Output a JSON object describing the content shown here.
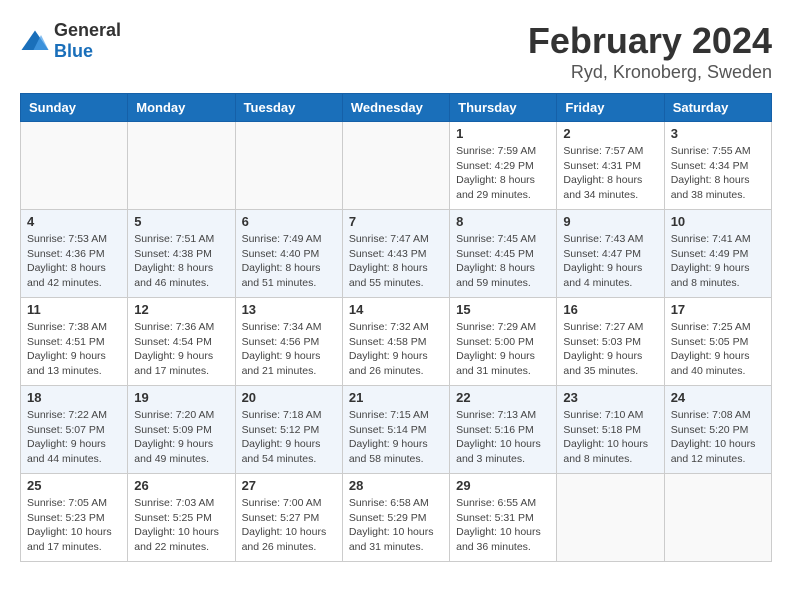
{
  "logo": {
    "general": "General",
    "blue": "Blue"
  },
  "title": "February 2024",
  "subtitle": "Ryd, Kronoberg, Sweden",
  "headers": [
    "Sunday",
    "Monday",
    "Tuesday",
    "Wednesday",
    "Thursday",
    "Friday",
    "Saturday"
  ],
  "weeks": [
    [
      {
        "day": "",
        "info": ""
      },
      {
        "day": "",
        "info": ""
      },
      {
        "day": "",
        "info": ""
      },
      {
        "day": "",
        "info": ""
      },
      {
        "day": "1",
        "info": "Sunrise: 7:59 AM\nSunset: 4:29 PM\nDaylight: 8 hours\nand 29 minutes."
      },
      {
        "day": "2",
        "info": "Sunrise: 7:57 AM\nSunset: 4:31 PM\nDaylight: 8 hours\nand 34 minutes."
      },
      {
        "day": "3",
        "info": "Sunrise: 7:55 AM\nSunset: 4:34 PM\nDaylight: 8 hours\nand 38 minutes."
      }
    ],
    [
      {
        "day": "4",
        "info": "Sunrise: 7:53 AM\nSunset: 4:36 PM\nDaylight: 8 hours\nand 42 minutes."
      },
      {
        "day": "5",
        "info": "Sunrise: 7:51 AM\nSunset: 4:38 PM\nDaylight: 8 hours\nand 46 minutes."
      },
      {
        "day": "6",
        "info": "Sunrise: 7:49 AM\nSunset: 4:40 PM\nDaylight: 8 hours\nand 51 minutes."
      },
      {
        "day": "7",
        "info": "Sunrise: 7:47 AM\nSunset: 4:43 PM\nDaylight: 8 hours\nand 55 minutes."
      },
      {
        "day": "8",
        "info": "Sunrise: 7:45 AM\nSunset: 4:45 PM\nDaylight: 8 hours\nand 59 minutes."
      },
      {
        "day": "9",
        "info": "Sunrise: 7:43 AM\nSunset: 4:47 PM\nDaylight: 9 hours\nand 4 minutes."
      },
      {
        "day": "10",
        "info": "Sunrise: 7:41 AM\nSunset: 4:49 PM\nDaylight: 9 hours\nand 8 minutes."
      }
    ],
    [
      {
        "day": "11",
        "info": "Sunrise: 7:38 AM\nSunset: 4:51 PM\nDaylight: 9 hours\nand 13 minutes."
      },
      {
        "day": "12",
        "info": "Sunrise: 7:36 AM\nSunset: 4:54 PM\nDaylight: 9 hours\nand 17 minutes."
      },
      {
        "day": "13",
        "info": "Sunrise: 7:34 AM\nSunset: 4:56 PM\nDaylight: 9 hours\nand 21 minutes."
      },
      {
        "day": "14",
        "info": "Sunrise: 7:32 AM\nSunset: 4:58 PM\nDaylight: 9 hours\nand 26 minutes."
      },
      {
        "day": "15",
        "info": "Sunrise: 7:29 AM\nSunset: 5:00 PM\nDaylight: 9 hours\nand 31 minutes."
      },
      {
        "day": "16",
        "info": "Sunrise: 7:27 AM\nSunset: 5:03 PM\nDaylight: 9 hours\nand 35 minutes."
      },
      {
        "day": "17",
        "info": "Sunrise: 7:25 AM\nSunset: 5:05 PM\nDaylight: 9 hours\nand 40 minutes."
      }
    ],
    [
      {
        "day": "18",
        "info": "Sunrise: 7:22 AM\nSunset: 5:07 PM\nDaylight: 9 hours\nand 44 minutes."
      },
      {
        "day": "19",
        "info": "Sunrise: 7:20 AM\nSunset: 5:09 PM\nDaylight: 9 hours\nand 49 minutes."
      },
      {
        "day": "20",
        "info": "Sunrise: 7:18 AM\nSunset: 5:12 PM\nDaylight: 9 hours\nand 54 minutes."
      },
      {
        "day": "21",
        "info": "Sunrise: 7:15 AM\nSunset: 5:14 PM\nDaylight: 9 hours\nand 58 minutes."
      },
      {
        "day": "22",
        "info": "Sunrise: 7:13 AM\nSunset: 5:16 PM\nDaylight: 10 hours\nand 3 minutes."
      },
      {
        "day": "23",
        "info": "Sunrise: 7:10 AM\nSunset: 5:18 PM\nDaylight: 10 hours\nand 8 minutes."
      },
      {
        "day": "24",
        "info": "Sunrise: 7:08 AM\nSunset: 5:20 PM\nDaylight: 10 hours\nand 12 minutes."
      }
    ],
    [
      {
        "day": "25",
        "info": "Sunrise: 7:05 AM\nSunset: 5:23 PM\nDaylight: 10 hours\nand 17 minutes."
      },
      {
        "day": "26",
        "info": "Sunrise: 7:03 AM\nSunset: 5:25 PM\nDaylight: 10 hours\nand 22 minutes."
      },
      {
        "day": "27",
        "info": "Sunrise: 7:00 AM\nSunset: 5:27 PM\nDaylight: 10 hours\nand 26 minutes."
      },
      {
        "day": "28",
        "info": "Sunrise: 6:58 AM\nSunset: 5:29 PM\nDaylight: 10 hours\nand 31 minutes."
      },
      {
        "day": "29",
        "info": "Sunrise: 6:55 AM\nSunset: 5:31 PM\nDaylight: 10 hours\nand 36 minutes."
      },
      {
        "day": "",
        "info": ""
      },
      {
        "day": "",
        "info": ""
      }
    ]
  ]
}
